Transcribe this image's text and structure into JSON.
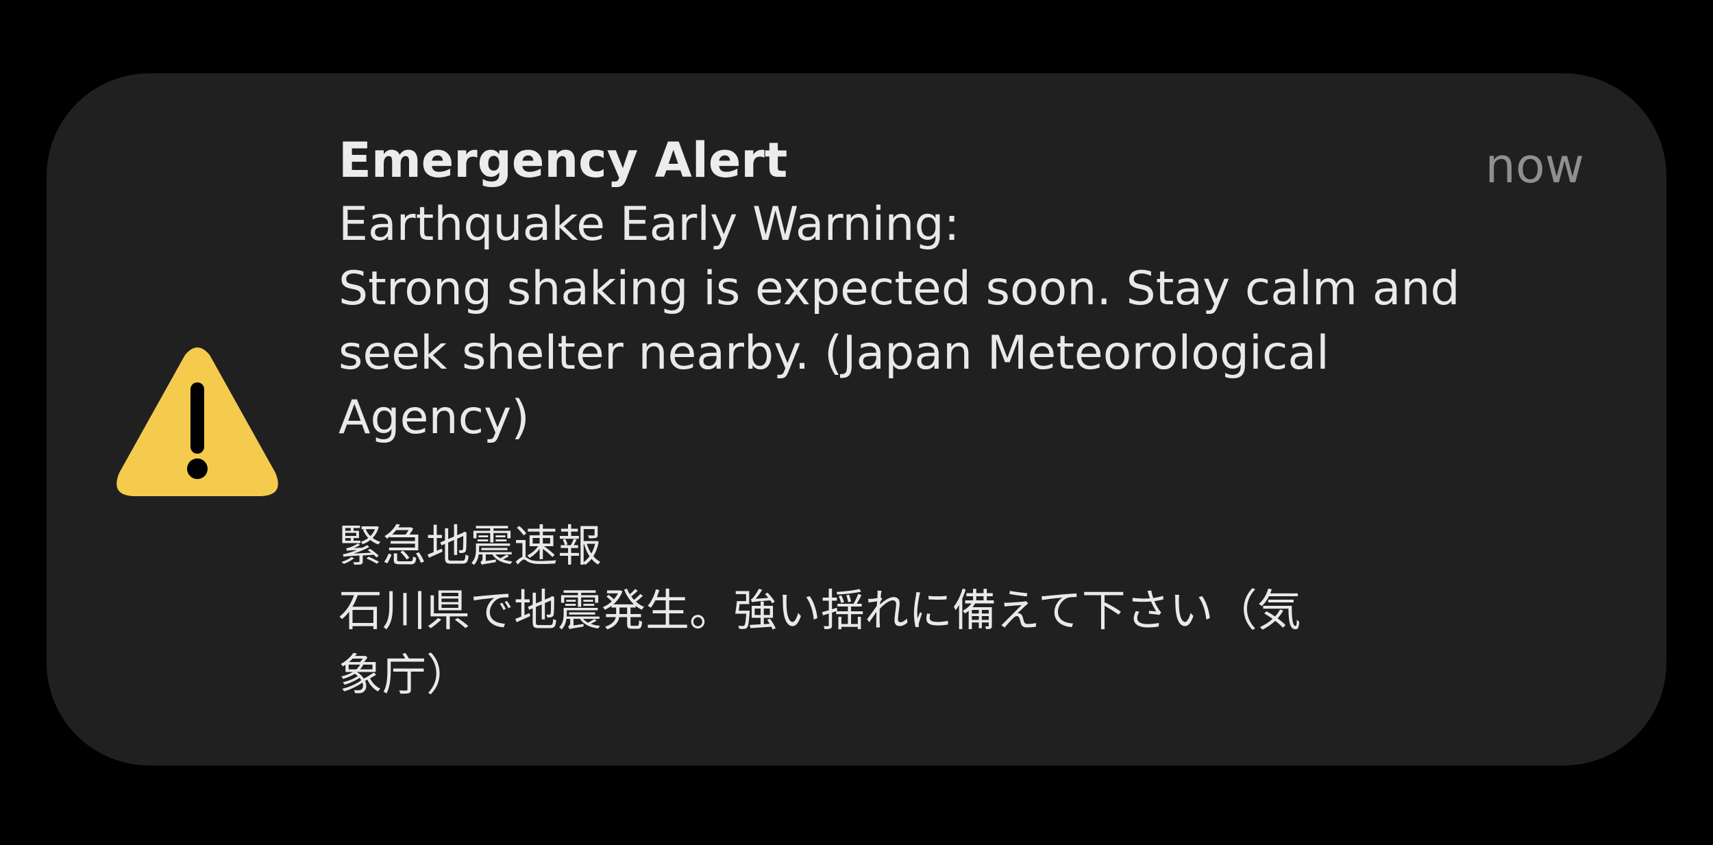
{
  "notification": {
    "title": "Emergency Alert",
    "timestamp": "now",
    "icon": "warning-triangle-icon",
    "accent_color": "#F5CB4E",
    "background_color": "#202020",
    "body_en": {
      "heading": "Earthquake Early Warning:",
      "lines": [
        "Strong shaking is expected soon. Stay calm and",
        "seek shelter nearby. (Japan Meteorological",
        "Agency)"
      ]
    },
    "body_ja": {
      "heading": "緊急地震速報",
      "lines": [
        "石川県で地震発生。強い揺れに備えて下さい（気",
        "象庁）"
      ]
    }
  }
}
